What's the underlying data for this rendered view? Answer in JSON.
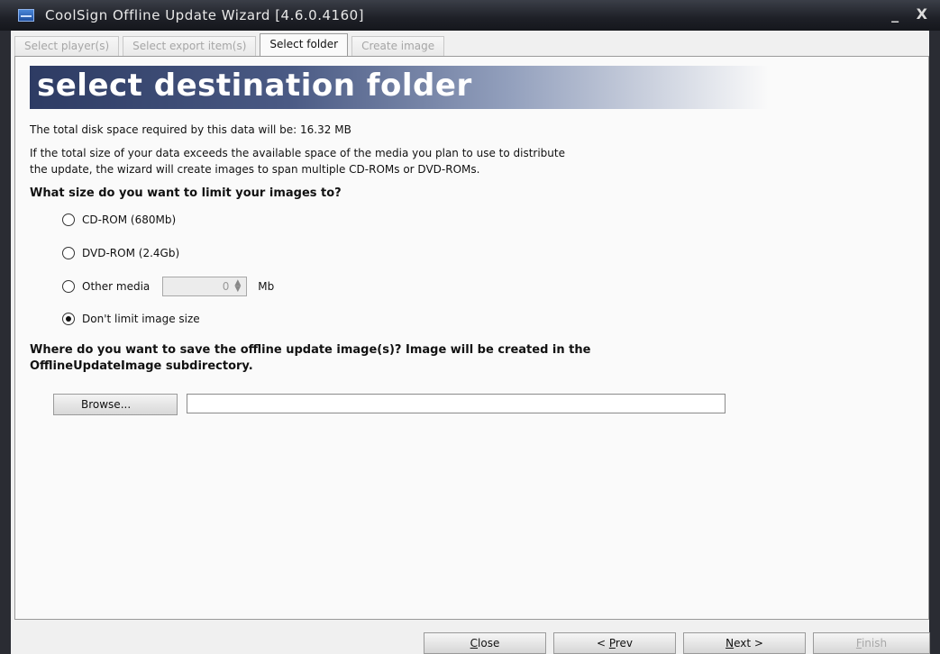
{
  "window": {
    "title": "CoolSign Offline Update Wizard [4.6.0.4160]",
    "minimize_glyph": "_",
    "close_glyph": "X"
  },
  "tabs": [
    {
      "label": "Select player(s)",
      "active": false
    },
    {
      "label": "Select export item(s)",
      "active": false
    },
    {
      "label": "Select folder",
      "active": true
    },
    {
      "label": "Create image",
      "active": false
    }
  ],
  "banner": {
    "title": "select destination folder"
  },
  "info": {
    "disk_space": "The total disk space required by this data will be:  16.32 MB",
    "span_line1": "If the total size of your data exceeds the available space of the media you plan to use to distribute",
    "span_line2": "the update, the wizard will create images to span multiple CD-ROMs or DVD-ROMs."
  },
  "size_question": "What size do you want to limit your images to?",
  "size_options": [
    {
      "label": "CD-ROM (680Mb)",
      "checked": false
    },
    {
      "label": "DVD-ROM (2.4Gb)",
      "checked": false
    },
    {
      "label": "Other media",
      "checked": false
    },
    {
      "label": "Don't limit image size",
      "checked": true
    }
  ],
  "other_media": {
    "value": "0",
    "unit": "Mb"
  },
  "save_question": {
    "line1": "Where do you want to save the offline update image(s)? Image will be created in the",
    "line2": "OfflineUpdateImage subdirectory."
  },
  "browse": {
    "label": "Browse...",
    "path_value": ""
  },
  "footer": {
    "close": {
      "pre": "",
      "accel": "C",
      "post": "lose"
    },
    "prev": {
      "pre": "< ",
      "accel": "P",
      "post": "rev"
    },
    "next": {
      "pre": "",
      "accel": "N",
      "post": "ext >"
    },
    "finish": {
      "pre": "",
      "accel": "F",
      "post": "inish"
    }
  }
}
